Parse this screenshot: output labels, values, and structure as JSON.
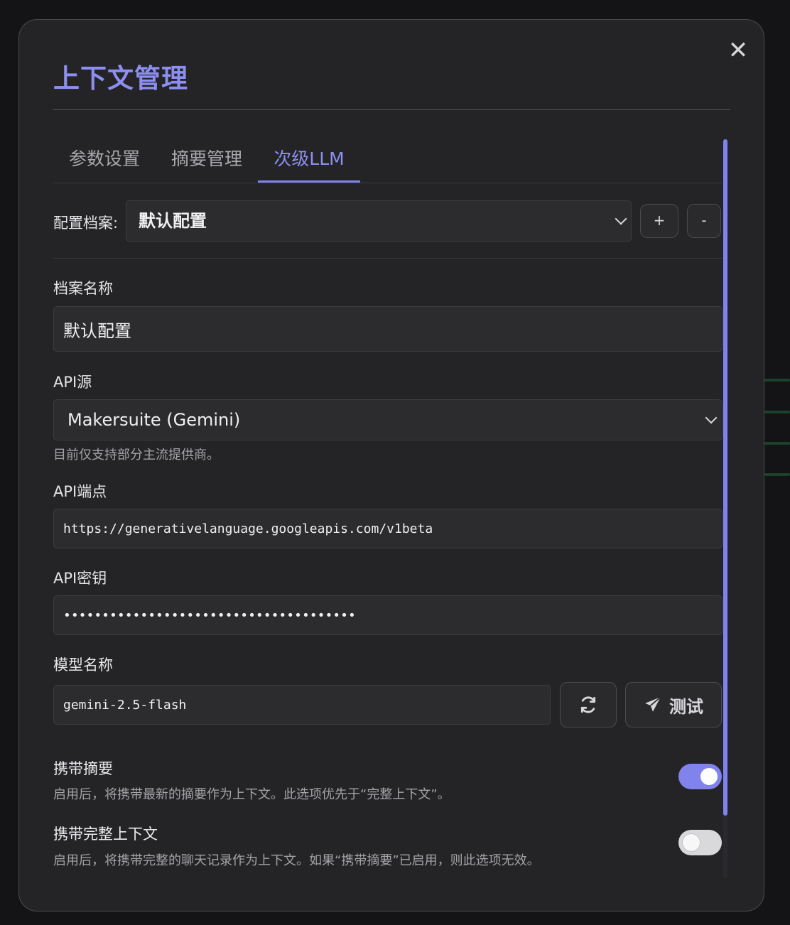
{
  "modal": {
    "title": "上下文管理",
    "close_icon": "close-icon"
  },
  "tabs": [
    {
      "label": "参数设置",
      "active": false
    },
    {
      "label": "摘要管理",
      "active": false
    },
    {
      "label": "次级LLM",
      "active": true
    }
  ],
  "profile": {
    "label": "配置档案:",
    "selected": "默认配置",
    "add_label": "+",
    "remove_label": "-"
  },
  "fields": {
    "profile_name": {
      "label": "档案名称",
      "value": "默认配置"
    },
    "api_source": {
      "label": "API源",
      "selected": "Makersuite (Gemini)",
      "hint": "目前仅支持部分主流提供商。"
    },
    "api_endpoint": {
      "label": "API端点",
      "value": "https://generativelanguage.googleapis.com/v1beta"
    },
    "api_key": {
      "label": "API密钥",
      "value": "••••••••••••••••••••••••••••••••••••••"
    },
    "model_name": {
      "label": "模型名称",
      "value": "gemini-2.5-flash",
      "refresh_icon": "refresh-icon",
      "test_label": "测试",
      "test_icon": "send-icon"
    }
  },
  "toggles": [
    {
      "title": "携带摘要",
      "desc": "启用后，将携带最新的摘要作为上下文。此选项优先于“完整上下文”。",
      "on": true
    },
    {
      "title": "携带完整上下文",
      "desc": "启用后，将携带完整的聊天记录作为上下文。如果“携带摘要”已启用，则此选项无效。",
      "on": false
    }
  ],
  "colors": {
    "accent": "#8083ec",
    "title": "#8d8ff0",
    "panel": "#242426",
    "input": "#2c2c2f"
  }
}
